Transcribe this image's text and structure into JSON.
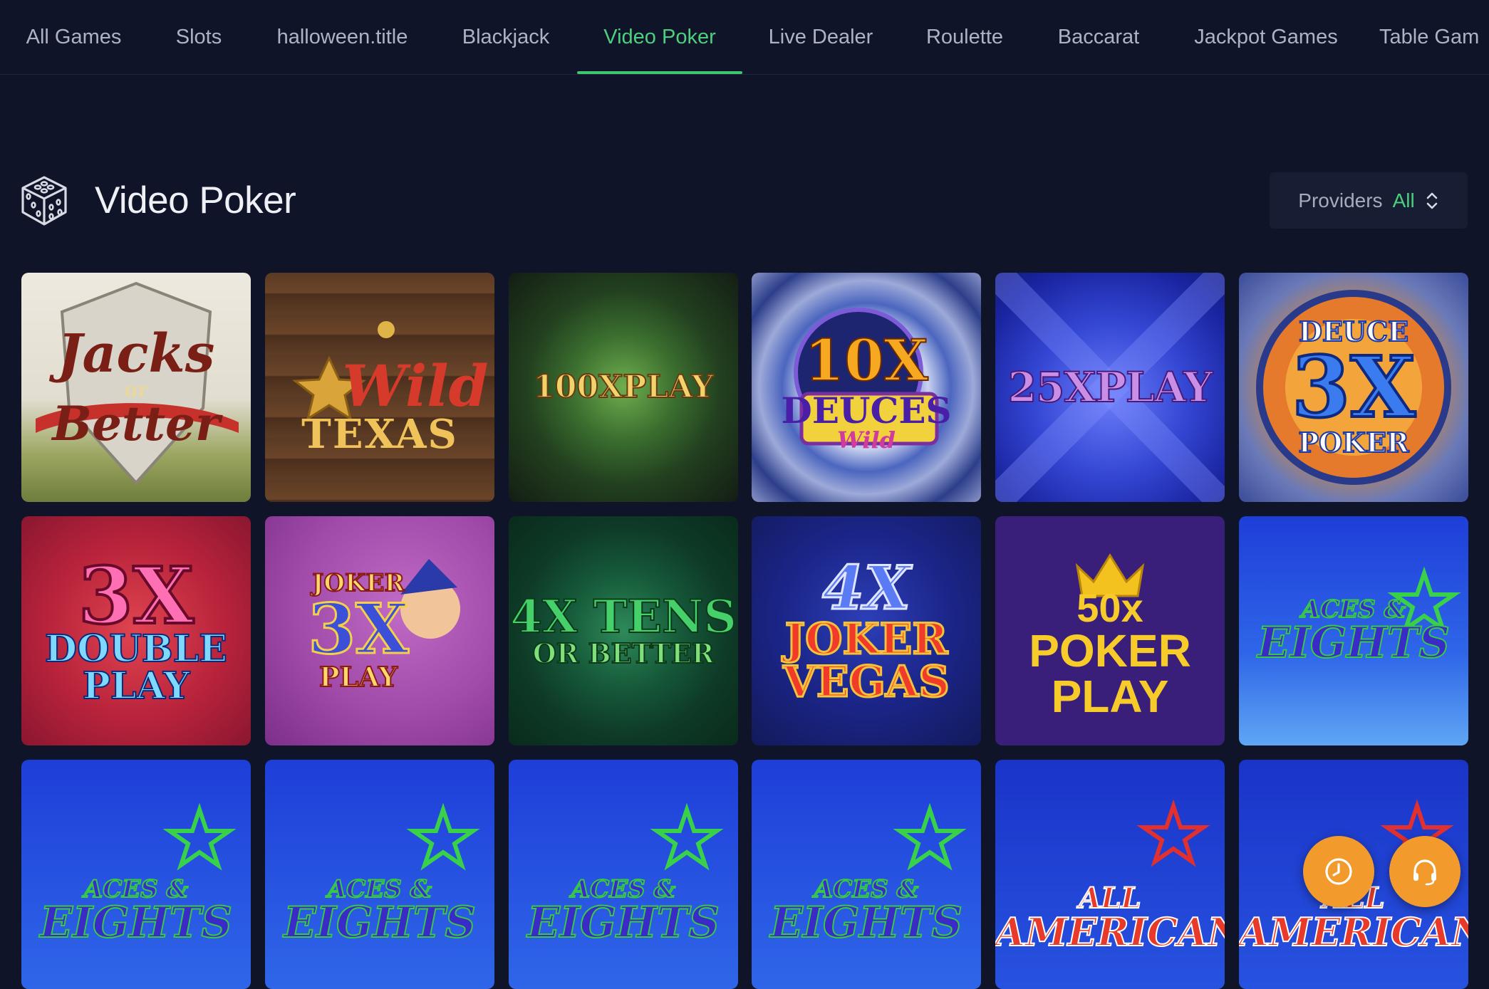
{
  "nav": {
    "tabs": [
      {
        "label": "All Games"
      },
      {
        "label": "Slots"
      },
      {
        "label": "halloween.title"
      },
      {
        "label": "Blackjack"
      },
      {
        "label": "Video Poker",
        "active": true
      },
      {
        "label": "Live Dealer"
      },
      {
        "label": "Roulette"
      },
      {
        "label": "Baccarat"
      },
      {
        "label": "Jackpot Games"
      },
      {
        "label": "Table Gam"
      }
    ]
  },
  "section": {
    "icon": "dice-icon",
    "title": "Video Poker"
  },
  "providers": {
    "label": "Providers",
    "value": "All",
    "icon": "sort-arrows-icon"
  },
  "games": [
    {
      "art": [
        "Jacks",
        "or",
        "Better"
      ]
    },
    {
      "art": [
        "Wild",
        "TEXAS"
      ]
    },
    {
      "art": [
        "100XPLAY"
      ]
    },
    {
      "art": [
        "10X",
        "DEUCES",
        "Wild"
      ]
    },
    {
      "art": [
        "25XPLAY"
      ]
    },
    {
      "art": [
        "DEUCE",
        "3X",
        "POKER"
      ]
    },
    {
      "art": [
        "3X",
        "DOUBLE",
        "PLAY"
      ]
    },
    {
      "art": [
        "JOKER",
        "3X",
        "PLAY"
      ]
    },
    {
      "art": [
        "4X TENS",
        "OR BETTER"
      ]
    },
    {
      "art": [
        "4X",
        "JOKER",
        "VEGAS"
      ]
    },
    {
      "art": [
        "50x",
        "POKER",
        "PLAY"
      ]
    },
    {
      "art": [
        "ACES &",
        "EIGHTS"
      ]
    },
    {
      "art": [
        "ACES &",
        "EIGHTS"
      ]
    },
    {
      "art": [
        "ACES &",
        "EIGHTS"
      ]
    },
    {
      "art": [
        "ACES &",
        "EIGHTS"
      ]
    },
    {
      "art": [
        "ACES &",
        "EIGHTS"
      ]
    },
    {
      "art": [
        "ALL",
        "AMERICAN"
      ]
    },
    {
      "art": [
        "ALL",
        "AMERICAN"
      ]
    }
  ],
  "fabs": [
    {
      "icon": "clock-icon"
    },
    {
      "icon": "headset-icon"
    }
  ],
  "colors": {
    "background": "#0f1429",
    "accent": "#4cd07d",
    "fab": "#f29b2c"
  }
}
